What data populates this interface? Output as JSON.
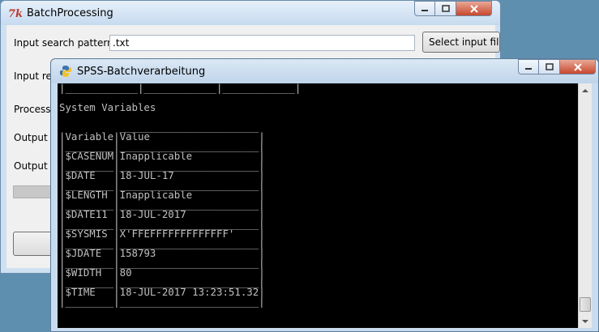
{
  "back_window": {
    "title": "BatchProcessing",
    "icon": "tk-feather-icon",
    "labels": {
      "input_pattern": "Input search pattern",
      "input_reg_partial": "Input reg",
      "processing_partial": "Processi",
      "output_f_partial": "Output f",
      "output_d_partial": "Output d"
    },
    "input_pattern_value": ".txt",
    "select_button": "Select input file"
  },
  "front_window": {
    "title": "SPSS-Batchverarbeitung",
    "icon": "python-icon",
    "console_header": "System Variables",
    "table": {
      "columns": [
        "Variable",
        "Value"
      ],
      "rows": [
        [
          "$CASENUM",
          "Inapplicable"
        ],
        [
          "$DATE",
          "18-JUL-17"
        ],
        [
          "$LENGTH",
          "Inapplicable"
        ],
        [
          "$DATE11",
          "18-JUL-2017"
        ],
        [
          "$SYSMIS",
          "X'FFEFFFFFFFFFFFFF'"
        ],
        [
          "$JDATE",
          "158793"
        ],
        [
          "$WIDTH",
          "80"
        ],
        [
          "$TIME",
          "18-JUL-2017 13:23:51.32"
        ]
      ]
    }
  },
  "colors": {
    "console_bg": "#000000",
    "console_text": "#c0c0c0",
    "window_frame": "#c9dcef"
  }
}
